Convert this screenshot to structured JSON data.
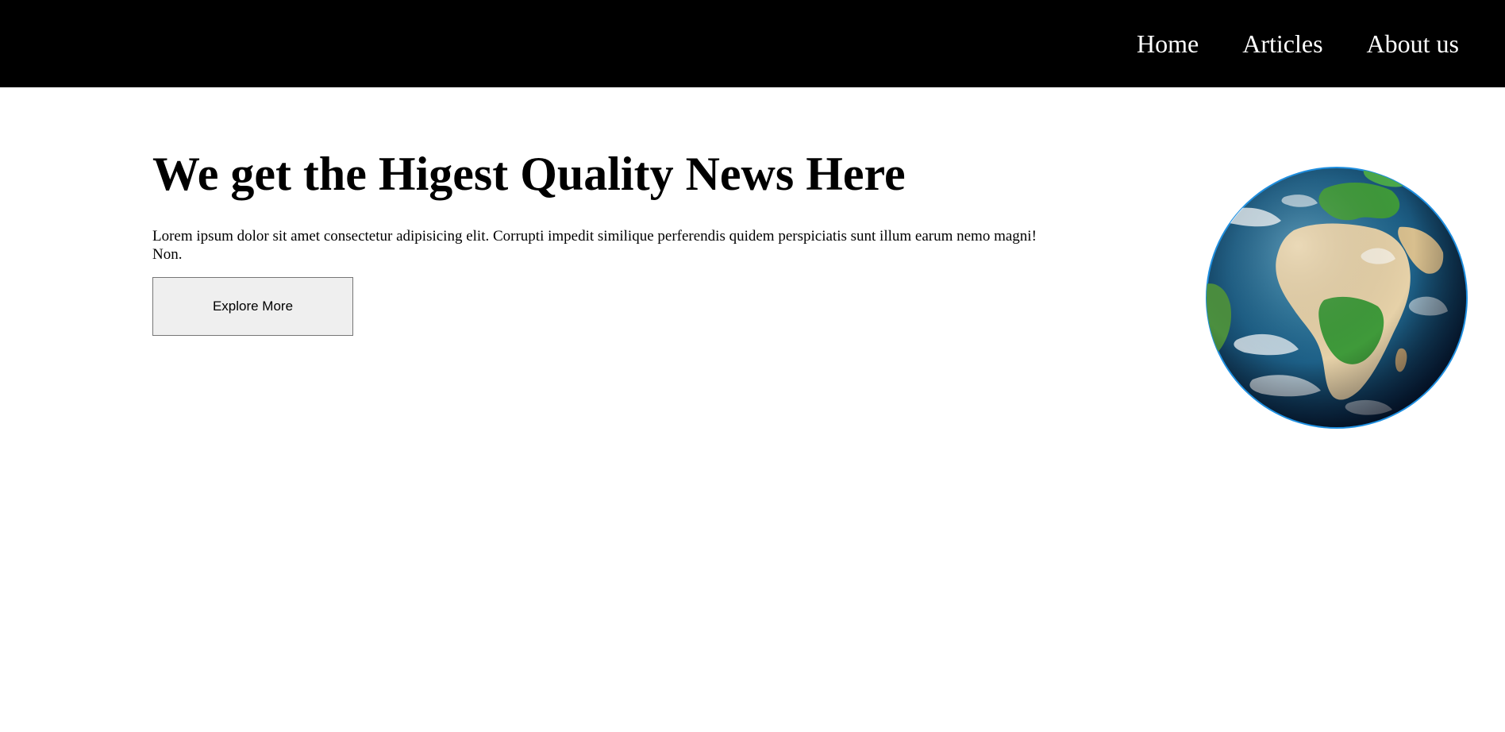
{
  "nav": {
    "links": [
      {
        "label": "Home"
      },
      {
        "label": "Articles"
      },
      {
        "label": "About us"
      }
    ]
  },
  "hero": {
    "title": "We get the Higest Quality News Here",
    "description": "Lorem ipsum dolor sit amet consectetur adipisicing elit. Corrupti impedit similique perferendis quidem perspiciatis sunt illum earum nemo magni! Non.",
    "button_label": "Explore More"
  },
  "globe": {
    "icon": "earth-globe-image"
  },
  "colors": {
    "navbar_bg": "#000000",
    "nav_text": "#ffffff",
    "page_bg": "#ffffff",
    "button_bg": "#efefef",
    "globe_ocean": "#1d5f86",
    "globe_land": "#3f9a3a",
    "globe_desert": "#e6d1a8",
    "globe_rim": "#1f8fe0"
  }
}
